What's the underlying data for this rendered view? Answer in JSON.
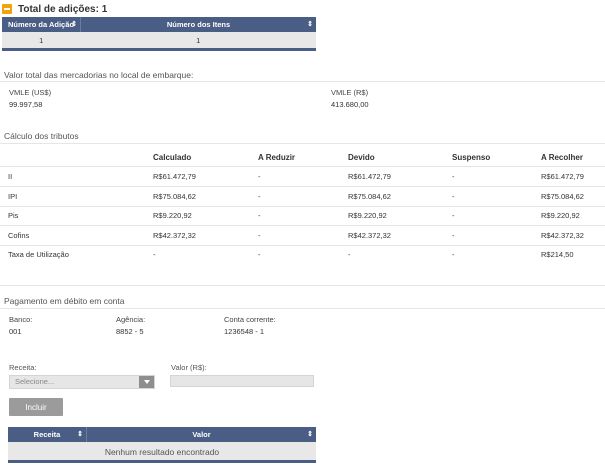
{
  "header": {
    "title": "Total de adições: 1"
  },
  "adicoes_table": {
    "columns": [
      "Número da Adição",
      "Número dos Itens"
    ],
    "rows": [
      [
        "1",
        "1"
      ]
    ]
  },
  "mercadorias": {
    "title": "Valor total das mercadorias no local de embarque:",
    "vmle_usd_label": "VMLE (US$)",
    "vmle_usd_value": "99.997,58",
    "vmle_brl_label": "VMLE (R$)",
    "vmle_brl_value": "413.680,00"
  },
  "tributos": {
    "title": "Cálculo dos tributos",
    "columns": [
      "Calculado",
      "A Reduzir",
      "Devido",
      "Suspenso",
      "A Recolher"
    ],
    "rows": [
      {
        "name": "II",
        "values": [
          "R$61.472,79",
          "-",
          "R$61.472,79",
          "-",
          "R$61.472,79"
        ]
      },
      {
        "name": "IPI",
        "values": [
          "R$75.084,62",
          "-",
          "R$75.084,62",
          "-",
          "R$75.084,62"
        ]
      },
      {
        "name": "Pis",
        "values": [
          "R$9.220,92",
          "-",
          "R$9.220,92",
          "-",
          "R$9.220,92"
        ]
      },
      {
        "name": "Cofins",
        "values": [
          "R$42.372,32",
          "-",
          "R$42.372,32",
          "-",
          "R$42.372,32"
        ]
      },
      {
        "name": "Taxa de Utilização",
        "values": [
          "-",
          "-",
          "-",
          "-",
          "R$214,50"
        ]
      }
    ]
  },
  "pagamento": {
    "title": "Pagamento em débito em conta",
    "banco_label": "Banco:",
    "banco_value": "001",
    "agencia_label": "Agência:",
    "agencia_value": "8852 - 5",
    "conta_label": "Conta corrente:",
    "conta_value": "1236548 - 1"
  },
  "form": {
    "receita_label": "Receita:",
    "receita_placeholder": "Selecione...",
    "valor_label": "Valor (R$):",
    "valor_value": "",
    "incluir_label": "Incluir"
  },
  "receita_table": {
    "columns": [
      "Receita",
      "Valor"
    ],
    "empty_message": "Nenhum resultado encontrado"
  },
  "colors": {
    "accent": "#f0a30a",
    "table_header": "#4a5d84"
  }
}
